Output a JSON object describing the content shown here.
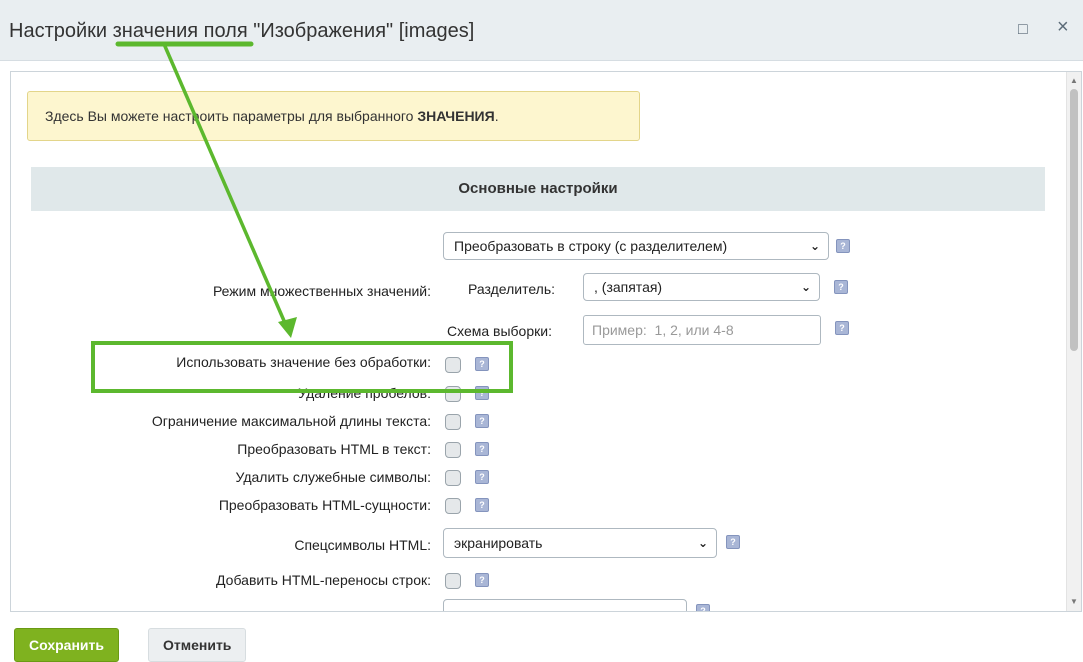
{
  "dialog": {
    "title": "Настройки значения поля \"Изображения\" [images]",
    "maximize_glyph": "□",
    "close_glyph": "×"
  },
  "notice": {
    "text_before": "Здесь Вы можете настроить параметры для выбранного ",
    "text_bold": "ЗНАЧЕНИЯ",
    "text_after": "."
  },
  "section": {
    "title": "Основные настройки"
  },
  "fields": {
    "multi_mode": {
      "label": "Режим множественных значений:",
      "select_value": "Преобразовать в строку (с разделителем)",
      "separator_label": "Разделитель:",
      "separator_value": ", (запятая)",
      "scheme_label": "Схема выборки:",
      "scheme_placeholder": "Пример:  1, 2, или 4-8"
    },
    "raw_value": {
      "label": "Использовать значение без обработки:",
      "checked": false
    },
    "trim_spaces": {
      "label": "Удаление пробелов:",
      "checked": false
    },
    "max_length": {
      "label": "Ограничение максимальной длины текста:",
      "checked": false
    },
    "html_to_text": {
      "label": "Преобразовать HTML в текст:",
      "checked": false
    },
    "remove_special": {
      "label": "Удалить служебные символы:",
      "checked": false
    },
    "html_entities": {
      "label": "Преобразовать HTML-сущности:",
      "checked": false
    },
    "html_specialchars": {
      "label": "Спецсимволы HTML:",
      "select_value": "экранировать"
    },
    "add_br": {
      "label": "Добавить HTML-переносы строк:",
      "checked": false
    }
  },
  "help_glyph": "?",
  "scroll": {
    "up_glyph": "▲",
    "down_glyph": "▼"
  },
  "buttons": {
    "save": "Сохранить",
    "cancel": "Отменить"
  },
  "colors": {
    "annotation": "#5cb82e",
    "save_button": "#7fb21f",
    "notice_bg": "#fdf6cf",
    "section_bg": "#e0e8ea"
  }
}
